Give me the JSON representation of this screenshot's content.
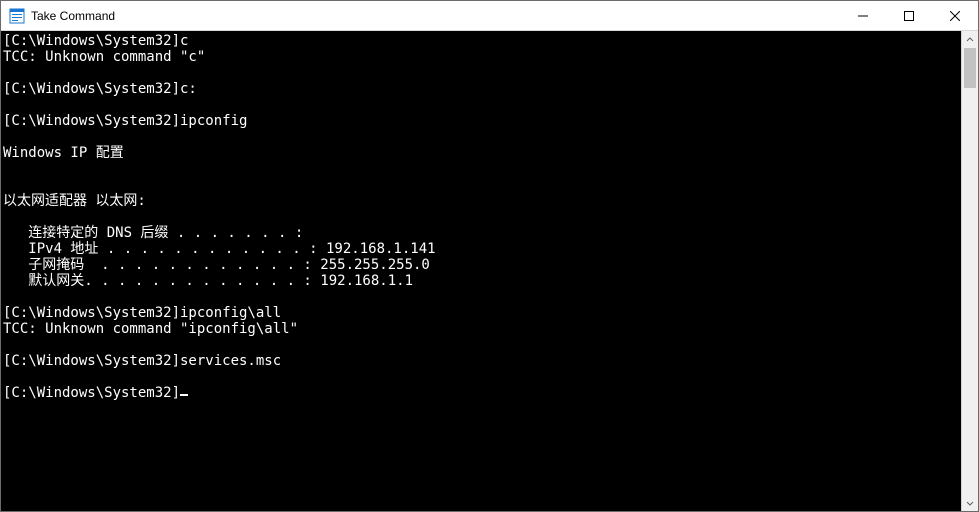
{
  "window": {
    "title": "Take Command"
  },
  "terminal": {
    "lines": [
      "[C:\\Windows\\System32]c",
      "TCC: Unknown command \"c\"",
      "",
      "[C:\\Windows\\System32]c:",
      "",
      "[C:\\Windows\\System32]ipconfig",
      "",
      "Windows IP 配置",
      "",
      "",
      "以太网适配器 以太网:",
      "",
      "   连接特定的 DNS 后缀 . . . . . . . :",
      "   IPv4 地址 . . . . . . . . . . . . : 192.168.1.141",
      "   子网掩码  . . . . . . . . . . . . : 255.255.255.0",
      "   默认网关. . . . . . . . . . . . . : 192.168.1.1",
      "",
      "[C:\\Windows\\System32]ipconfig\\all",
      "TCC: Unknown command \"ipconfig\\all\"",
      "",
      "[C:\\Windows\\System32]services.msc",
      "",
      "[C:\\Windows\\System32]"
    ]
  }
}
